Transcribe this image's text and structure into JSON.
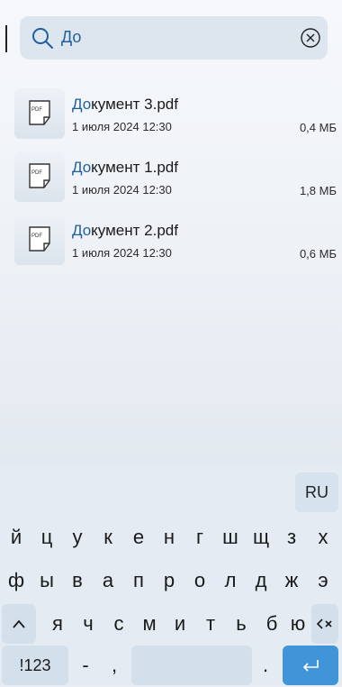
{
  "search": {
    "query": "До"
  },
  "files": [
    {
      "highlight": "До",
      "rest": "кумент 3.pdf",
      "date": "1 июля 2024 12:30",
      "size": "0,4 МБ",
      "icon_text": "PDF"
    },
    {
      "highlight": "До",
      "rest": "кумент 1.pdf",
      "date": "1 июля 2024 12:30",
      "size": "1,8 МБ",
      "icon_text": "PDF"
    },
    {
      "highlight": "До",
      "rest": "кумент 2.pdf",
      "date": "1 июля 2024 12:30",
      "size": "0,6 МБ",
      "icon_text": "PDF"
    }
  ],
  "keyboard": {
    "lang": "RU",
    "row1": [
      "й",
      "ц",
      "у",
      "к",
      "е",
      "н",
      "г",
      "ш",
      "щ",
      "з",
      "х"
    ],
    "row2": [
      "ф",
      "ы",
      "в",
      "а",
      "п",
      "р",
      "о",
      "л",
      "д",
      "ж",
      "э"
    ],
    "row3": [
      "я",
      "ч",
      "с",
      "м",
      "и",
      "т",
      "ь",
      "б",
      "ю"
    ],
    "numbers_label": "!123",
    "dash": "-",
    "comma": ",",
    "period": "."
  },
  "colors": {
    "accent": "#1f5f9e",
    "enter_key": "#3f95d8"
  }
}
